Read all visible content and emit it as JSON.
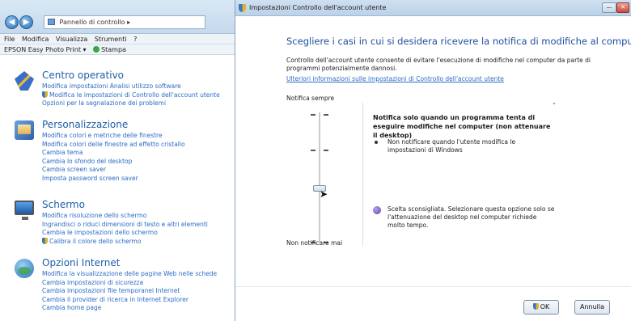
{
  "control_panel": {
    "address": "Pannello di controllo",
    "menu": [
      "File",
      "Modifica",
      "Visualizza",
      "Strumenti",
      "?"
    ],
    "epson": {
      "label": "EPSON Easy Photo Print",
      "dropdown": "▾",
      "stampa": "Stampa"
    },
    "categories": [
      {
        "title": "Centro operativo",
        "links": [
          "Modifica impostazioni Analisi utilizzo software",
          "Modifica le impostazioni di Controllo dell'account utente",
          "Opzioni per la segnalazione dei problemi"
        ]
      },
      {
        "title": "Personalizzazione",
        "links": [
          "Modifica colori e metriche delle finestre",
          "Modifica colori delle finestre ad effetto cristallo",
          "Cambia tema",
          "Cambia lo sfondo del desktop",
          "Cambia screen saver",
          "Imposta password screen saver"
        ]
      },
      {
        "title": "Schermo",
        "links": [
          "Modifica risoluzione dello schermo",
          "Ingrandisci o riduci dimensioni di testo e altri elementi",
          "Cambia le impostazioni dello schermo",
          "Calibra il colore dello schermo"
        ]
      },
      {
        "title": "Opzioni Internet",
        "links": [
          "Modifica la visualizzazione delle pagine Web nelle schede",
          "Cambia impostazioni di sicurezza",
          "Cambia impostazioni file temporanei Internet",
          "Cambia il provider di ricerca in Internet Explorer",
          "Cambia home page"
        ]
      }
    ]
  },
  "dialog": {
    "title": "Impostazioni Controllo dell'account utente",
    "minimize": "—",
    "close": "✕",
    "heading": "Scegliere i casi in cui si desidera ricevere la notifica di modifiche al computer",
    "description": "Controllo dell'account utente consente di evitare l'esecuzione di modifiche nel computer da parte di programmi potenzialmente dannosi.",
    "info_link": "Ulteriori informazioni sulle impostazioni di Controllo dell'account utente",
    "slider": {
      "top_label": "Notifica sempre",
      "bottom_label": "Non notificare mai",
      "selected_level": 3,
      "levels": 4
    },
    "info": {
      "title": "Notifica solo quando un programma tenta di eseguire modifiche nel computer (non attenuare il desktop)",
      "bullet": "Non notificare quando l'utente modifica le impostazioni di Windows",
      "warning": "Scelta sconsigliata. Selezionare questa opzione solo se l'attenuazione del desktop nel computer richiede molto tempo."
    },
    "buttons": {
      "ok": "OK",
      "cancel": "Annulla"
    }
  }
}
